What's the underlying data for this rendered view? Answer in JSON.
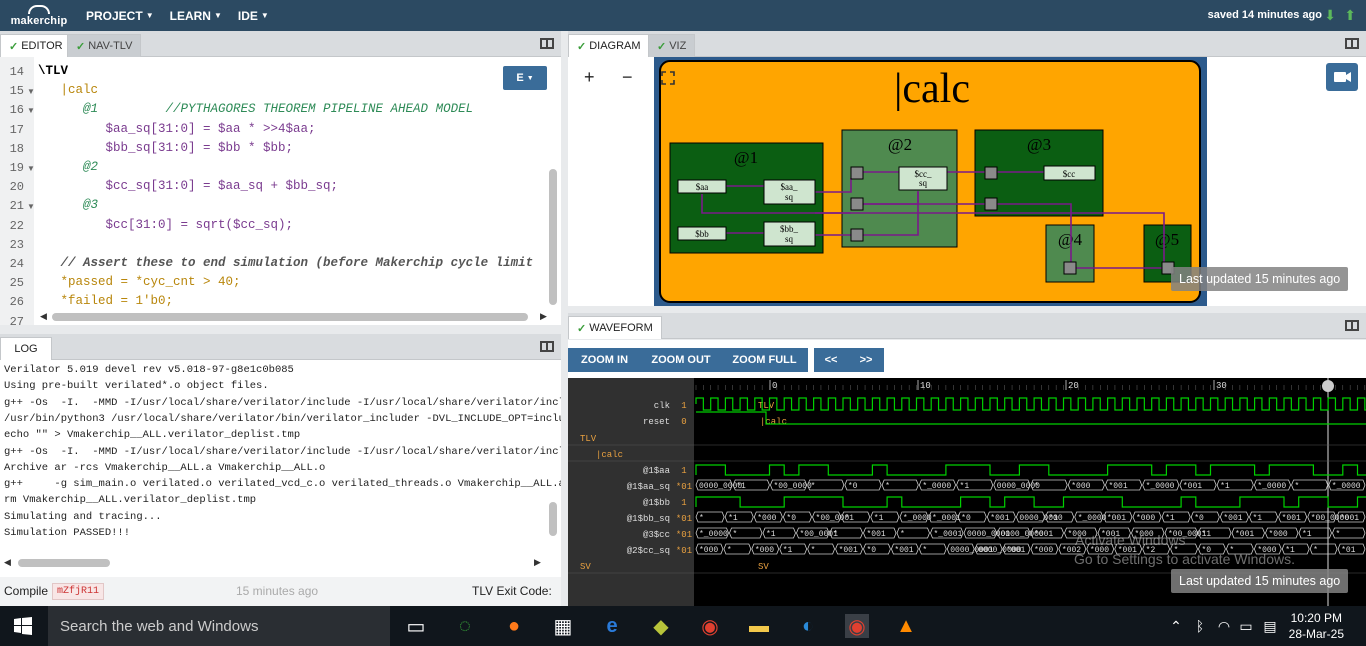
{
  "topbar": {
    "logo": "makerchip",
    "menus": [
      "PROJECT",
      "LEARN",
      "IDE"
    ],
    "saved": "saved 14 minutes ago"
  },
  "editor_tabs": {
    "editor": "EDITOR",
    "navtlv": "NAV-TLV",
    "e_button": "E"
  },
  "code_lines": [
    {
      "num": "14",
      "text": "\\TLV"
    },
    {
      "num": "15",
      "text": "   |calc"
    },
    {
      "num": "16",
      "text": "      @1         //PYTHAGORES THEOREM PIPELINE AHEAD MODEL"
    },
    {
      "num": "17",
      "text": "         $aa_sq[31:0] = $aa * >>4$aa;"
    },
    {
      "num": "18",
      "text": "         $bb_sq[31:0] = $bb * $bb;"
    },
    {
      "num": "19",
      "text": "      @2"
    },
    {
      "num": "20",
      "text": "         $cc_sq[31:0] = $aa_sq + $bb_sq;"
    },
    {
      "num": "21",
      "text": "      @3"
    },
    {
      "num": "22",
      "text": "         $cc[31:0] = sqrt($cc_sq);"
    },
    {
      "num": "23",
      "text": ""
    },
    {
      "num": "24",
      "text": "   // Assert these to end simulation (before Makerchip cycle limit"
    },
    {
      "num": "25",
      "text": "   *passed = *cyc_cnt > 40;"
    },
    {
      "num": "26",
      "text": "   *failed = 1'b0;"
    },
    {
      "num": "27",
      "text": ""
    }
  ],
  "log": {
    "tab": "LOG",
    "lines": [
      "Verilator 5.019 devel rev v5.018-97-g8e1c0b085",
      "Using pre-built verilated*.o object files.",
      "g++ -Os  -I.  -MMD -I/usr/local/share/verilator/include -I/usr/local/share/verilator/incluc",
      "/usr/bin/python3 /usr/local/share/verilator/bin/verilator_includer -DVL_INCLUDE_OPT=include",
      "echo \"\" > Vmakerchip__ALL.verilator_deplist.tmp",
      "g++ -Os  -I.  -MMD -I/usr/local/share/verilator/include -I/usr/local/share/verilator/incluc",
      "Archive ar -rcs Vmakerchip__ALL.a Vmakerchip__ALL.o",
      "g++     -g sim_main.o verilated.o verilated_vcd_c.o verilated_threads.o Vmakerchip__ALL.a",
      "rm Vmakerchip__ALL.verilator_deplist.tmp",
      "Simulating and tracing...",
      "Simulation PASSED!!!"
    ]
  },
  "footer": {
    "compile": "Compile",
    "compile_id": "mZfjR11",
    "time": "15 minutes ago",
    "exit": "TLV Exit Code:"
  },
  "diagram": {
    "tabs": {
      "diagram": "DIAGRAM",
      "viz": "VIZ"
    },
    "title": "|calc",
    "stages": [
      "@1",
      "@2",
      "@3",
      "@4",
      "@5"
    ],
    "signals": {
      "aa": "$aa",
      "bb": "$bb",
      "aa_sq": "$aa_",
      "aa_sq2": "sq",
      "bb_sq": "$bb_",
      "bb_sq2": "sq",
      "cc_sq": "$cc_",
      "cc_sq2": "sq",
      "cc": "$cc"
    },
    "updated": "Last updated 15 minutes ago",
    "zoom_in": "+",
    "zoom_out": "−"
  },
  "waveform": {
    "tab": "WAVEFORM",
    "buttons": [
      "ZOOM IN",
      "ZOOM OUT",
      "ZOOM FULL",
      "<<",
      ">>"
    ],
    "ticks": [
      "0",
      "10",
      "20",
      "30"
    ],
    "signals": [
      {
        "name": "clk",
        "val": "1"
      },
      {
        "name": "reset",
        "val": "0"
      },
      {
        "name": "TLV",
        "val": ""
      },
      {
        "name": "|calc",
        "val": ""
      },
      {
        "name": "@1$aa",
        "val": "1"
      },
      {
        "name": "@1$aa_sq",
        "val": "*01"
      },
      {
        "name": "@1$bb",
        "val": "1"
      },
      {
        "name": "@1$bb_sq",
        "val": "*01"
      },
      {
        "name": "@3$cc",
        "val": "*01"
      },
      {
        "name": "@2$cc_sq",
        "val": "*01"
      },
      {
        "name": "SV",
        "val": ""
      }
    ],
    "scope_tlv": "TLV",
    "scope_calc": "|calc",
    "scope_sv": "SV",
    "aa_sq_vals": [
      "0000_0000",
      "*1",
      "*00_0000",
      "*",
      "*0",
      "*",
      "*_0000",
      "*1",
      "0000_0000",
      "*",
      "*000",
      "*001",
      "*_0000",
      "*001",
      "*1",
      "*_0000",
      "*",
      "*_0000"
    ],
    "bb_sq_vals": [
      "*",
      "*1",
      "*000",
      "*0",
      "*00_0001",
      "*",
      "*1",
      "*_0000",
      "*_0001",
      "*0",
      "*001",
      "0000_0000",
      "*1",
      "*_0000",
      "*001",
      "*000",
      "*1",
      "*0",
      "*001",
      "*1",
      "*001",
      "*00_0000",
      "*001"
    ],
    "cc_vals": [
      "*_0000",
      "*",
      "*1",
      "*00_0001",
      "*",
      "*001",
      "*",
      "*_0001",
      "0000_0001",
      "0000_0000",
      "*001",
      "*000",
      "*001",
      "*000",
      "*00_0001",
      "*1",
      "*001",
      "*000",
      "*1",
      "*"
    ],
    "cc_sq_vals": [
      "*000",
      "*",
      "*000",
      "*1",
      "*",
      "*001",
      "*0",
      "*001",
      "*",
      "0000_0001",
      "0000_0000",
      "*001",
      "*000",
      "*002",
      "*000",
      "*001",
      "*2",
      "*",
      "*0",
      "*",
      "*000",
      "*1",
      "*",
      "*01"
    ],
    "updated": "Last updated 15 minutes ago",
    "activate1": "Activate Windows",
    "activate2": "Go to Settings to activate Windows."
  },
  "taskbar": {
    "search": "Search the web and Windows",
    "time": "10:20 PM",
    "date": "28-Mar-25"
  },
  "colors": {
    "nav": "#2c4a62",
    "button": "#3a6c99",
    "diagram_bg": "#ffa500",
    "stage_dark": "#0b5e12",
    "stage_light": "#4f8a4f",
    "wave_green": "#00d000"
  }
}
